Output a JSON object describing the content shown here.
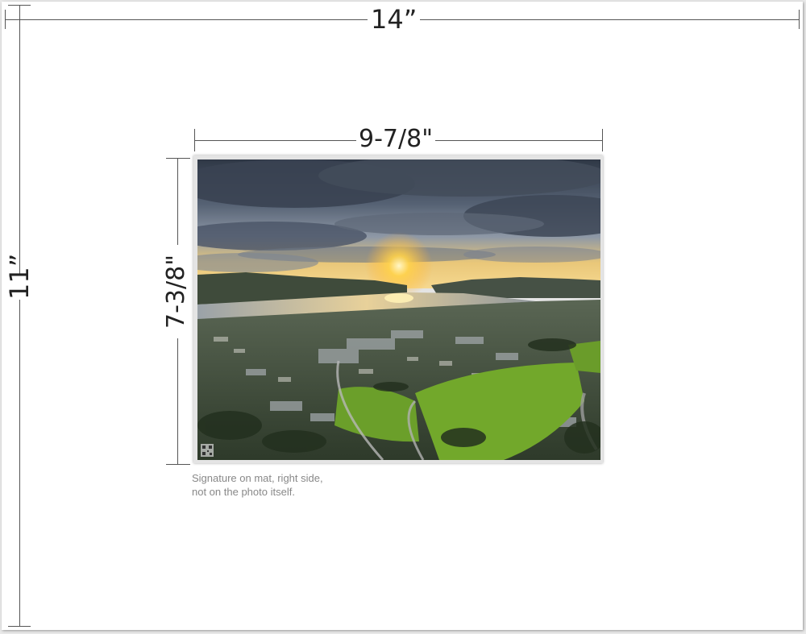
{
  "sheet": {
    "width_label": "14”",
    "height_label": "11”"
  },
  "print": {
    "width_label": "9-7/8\"",
    "height_label": "7-3/8\""
  },
  "photo": {
    "alt": "Aerial sunset view over a bay with a town, green hills and a bridge in the distance",
    "watermark": "QR code"
  },
  "note": {
    "line1": "Signature on mat, right side,",
    "line2": "not on the photo itself."
  },
  "colors": {
    "sheet": "#ffffff",
    "dimension_lines": "#555555",
    "note_text": "#888888",
    "sky_dark": "#3c4656",
    "sun": "#ffd24a",
    "water": "#c3b7a0",
    "grass": "#6a9c2a"
  }
}
